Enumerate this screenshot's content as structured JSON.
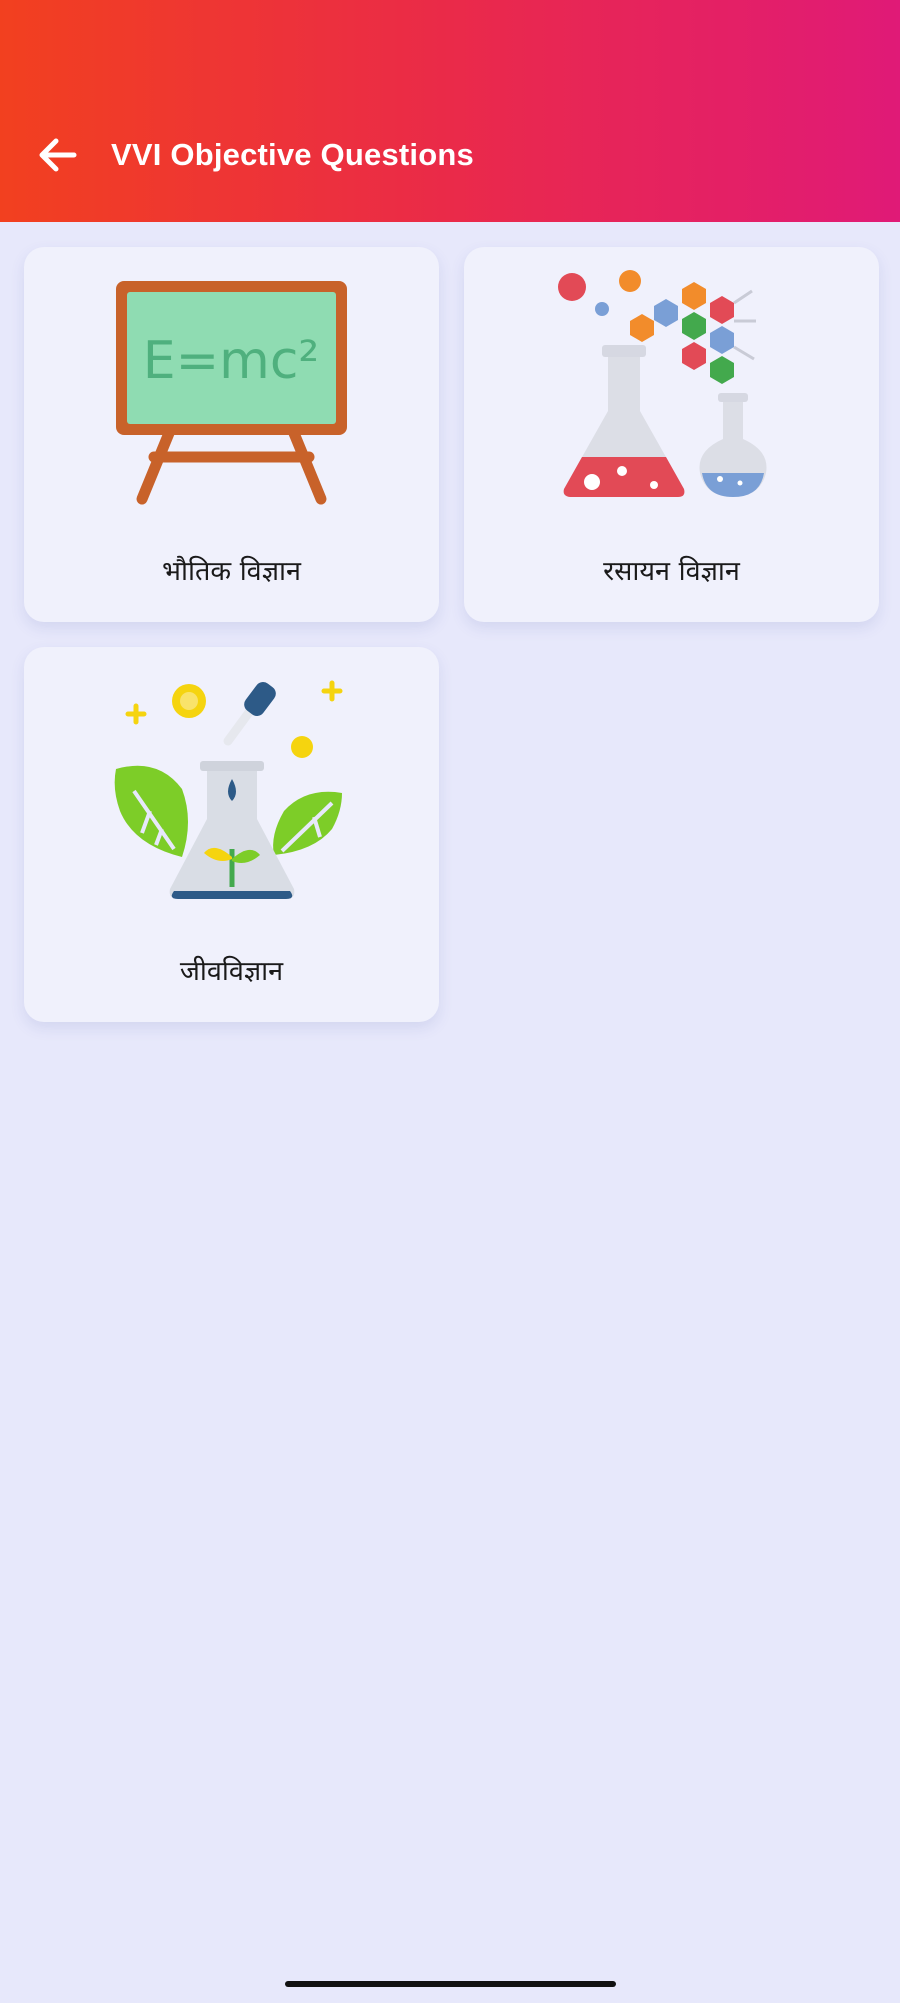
{
  "header": {
    "title": "VVI Objective Questions",
    "back_icon": "arrow-left-icon",
    "gradient_start": "#f2401f",
    "gradient_end": "#e01a77"
  },
  "subjects": [
    {
      "label": "भौतिक विज्ञान",
      "icon": "physics-blackboard-icon",
      "board_text": "E=mc²"
    },
    {
      "label": "रसायन विज्ञान",
      "icon": "chemistry-flask-icon"
    },
    {
      "label": "जीवविज्ञान",
      "icon": "biology-plant-flask-icon"
    }
  ],
  "colors": {
    "background": "#e7e8fb",
    "card": "#f0f1fc"
  }
}
